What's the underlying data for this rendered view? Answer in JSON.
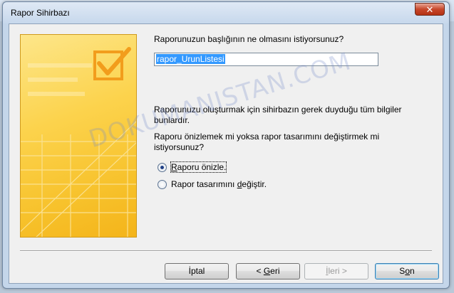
{
  "window": {
    "title": "Rapor Sihirbazı",
    "close_glyph": "✕"
  },
  "banner": {
    "icon": "checkbox-check-icon"
  },
  "question_title": "Raporunuzun başlığının ne olmasını istiyorsunuz?",
  "report_title_value": "rapor_UrunListesi",
  "info_text_line1": "Raporunuzu oluşturmak için sihirbazın gerek duyduğu tüm bilgiler",
  "info_text_line2": "bunlardır.",
  "preview_question_line1": "Raporu önizlemek mi yoksa rapor tasarımını değiştirmek mi",
  "preview_question_line2": "istiyorsunuz?",
  "options": {
    "preview": {
      "label_hot": "R",
      "label_rest": "aporu önizle.",
      "checked": true
    },
    "design": {
      "label_before": "Rapor tasarımını ",
      "label_hot": "d",
      "label_after": "eğiştir.",
      "checked": false
    }
  },
  "buttons": {
    "cancel": {
      "label": "İptal"
    },
    "back": {
      "prefix": "< ",
      "hot": "G",
      "rest": "eri"
    },
    "next": {
      "hot": "İ",
      "rest": "leri >",
      "disabled": true
    },
    "finish": {
      "before": "S",
      "hot": "o",
      "after": "n"
    }
  },
  "watermark": "DOKUMANISTAN.COM",
  "colors": {
    "banner_yellow": "#fcd34d",
    "banner_orange": "#f4b41a",
    "selection_blue": "#3399ff",
    "close_red": "#c7472a"
  }
}
